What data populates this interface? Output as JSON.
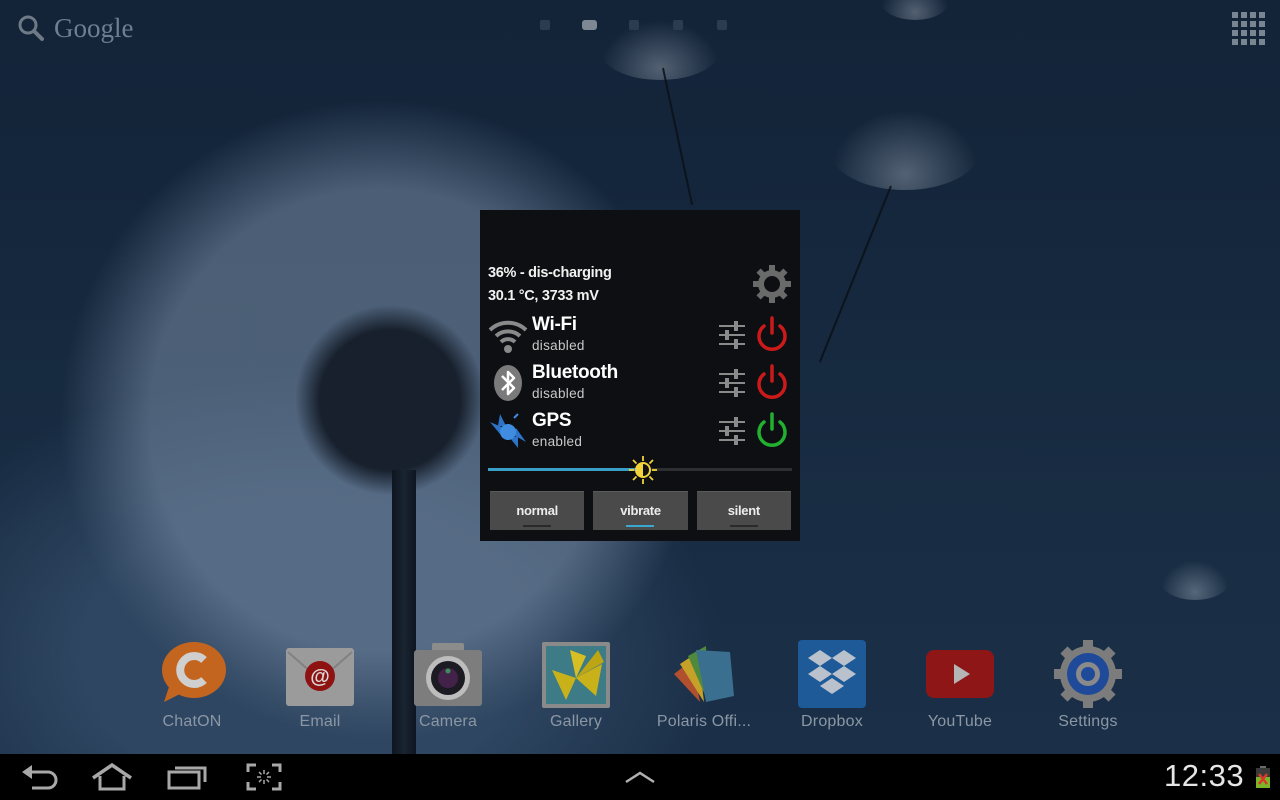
{
  "home": {
    "search": {
      "label": "Google",
      "icon": "search-icon"
    },
    "page_indicator": {
      "total": 5,
      "current": 2
    },
    "apps_button": {
      "icon": "apps-grid-icon"
    }
  },
  "widget": {
    "battery_line": "36% - dis-charging",
    "battery_details": "30.1 °C, 3733 mV",
    "settings_icon": "gear-icon",
    "toggles": [
      {
        "name": "Wi-Fi",
        "state": "disabled",
        "icon": "wifi-icon",
        "power_color": "#cc1a1a"
      },
      {
        "name": "Bluetooth",
        "state": "disabled",
        "icon": "bluetooth-icon",
        "power_color": "#cc1a1a"
      },
      {
        "name": "GPS",
        "state": "enabled",
        "icon": "gps-satellite-icon",
        "power_color": "#22b030"
      }
    ],
    "brightness": {
      "value_percent": 51,
      "accent": "#3a9fc7"
    },
    "sound_modes": [
      {
        "label": "normal",
        "active": false
      },
      {
        "label": "vibrate",
        "active": true
      },
      {
        "label": "silent",
        "active": false
      }
    ]
  },
  "dock": {
    "apps": [
      {
        "label": "ChatON",
        "icon": "chaton-icon"
      },
      {
        "label": "Email",
        "icon": "email-icon"
      },
      {
        "label": "Camera",
        "icon": "camera-icon"
      },
      {
        "label": "Gallery",
        "icon": "gallery-icon"
      },
      {
        "label": "Polaris Offi...",
        "icon": "polaris-office-icon"
      },
      {
        "label": "Dropbox",
        "icon": "dropbox-icon"
      },
      {
        "label": "YouTube",
        "icon": "youtube-icon"
      },
      {
        "label": "Settings",
        "icon": "settings-icon"
      }
    ]
  },
  "navbar": {
    "buttons": [
      "back",
      "home",
      "recent-apps",
      "screenshot"
    ],
    "center": "expand-up",
    "clock": "12:33",
    "battery_icon": "battery-charging-icon"
  }
}
